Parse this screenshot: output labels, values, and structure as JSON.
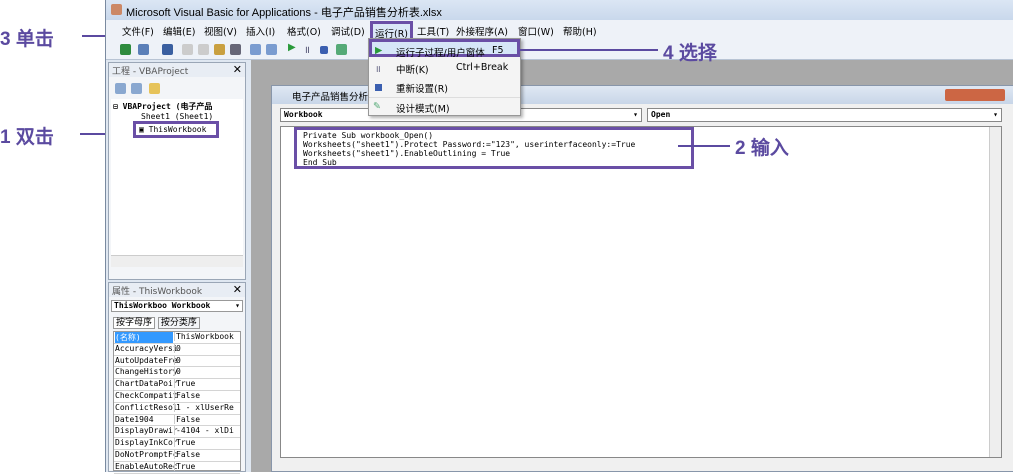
{
  "window": {
    "title": "Microsoft Visual Basic for Applications - 电子产品销售分析表.xlsx"
  },
  "menubar": [
    "文件(F)",
    "编辑(E)",
    "视图(V)",
    "插入(I)",
    "格式(O)",
    "调试(D)",
    "运行(R)",
    "工具(T)",
    "外接程序(A)",
    "窗口(W)",
    "帮助(H)"
  ],
  "run_menu": {
    "items": [
      {
        "label": "运行子过程/用户窗体",
        "shortcut": "F5",
        "icon": "play-icon"
      },
      {
        "label": "中断(K)",
        "shortcut": "Ctrl+Break",
        "icon": "pause-icon"
      },
      {
        "label": "重新设置(R)",
        "shortcut": "",
        "icon": "stop-icon"
      },
      {
        "label": "设计模式(M)",
        "shortcut": "",
        "icon": "design-mode-icon"
      }
    ]
  },
  "project": {
    "title": "工程 - VBAProject",
    "root": "VBAProject (电子产品",
    "sheet": "Sheet1 (Sheet1)",
    "workbook": "ThisWorkbook"
  },
  "properties": {
    "title": "属性 - ThisWorkbook",
    "object": "ThisWorkboo Workbook",
    "tabs": [
      "按字母序",
      "按分类序"
    ],
    "rows": [
      [
        "(名称)",
        "ThisWorkbook"
      ],
      [
        "AccuracyVersi",
        "0"
      ],
      [
        "AutoUpdateFre",
        "0"
      ],
      [
        "ChangeHistory",
        "0"
      ],
      [
        "ChartDataPoir",
        "True"
      ],
      [
        "CheckCompatit",
        "False"
      ],
      [
        "ConflictResol",
        "1 - xlUserRe"
      ],
      [
        "Date1904",
        "False"
      ],
      [
        "DisplayDrawir",
        "-4104 - xlDi"
      ],
      [
        "DisplayInkCor",
        "True"
      ],
      [
        "DoNotPromptFc",
        "False"
      ],
      [
        "EnableAutoRec",
        "True"
      ]
    ]
  },
  "code_window": {
    "title": "电子产品销售分析表",
    "object": "Workbook",
    "procedure": "Open",
    "lines": [
      "Private Sub workbook_Open()",
      "Worksheets(\"sheet1\").Protect Password:=\"123\", userinterfaceonly:=True",
      "Worksheets(\"sheet1\").EnableOutlining = True",
      "End Sub"
    ]
  },
  "annotations": {
    "a1": "1 双击",
    "a2": "2 输入",
    "a3": "3 单击",
    "a4": "4 选择"
  },
  "colors": {
    "annotation": "#5b4aa0",
    "highlight": "#6a4fa6",
    "selection": "#3399ff"
  }
}
